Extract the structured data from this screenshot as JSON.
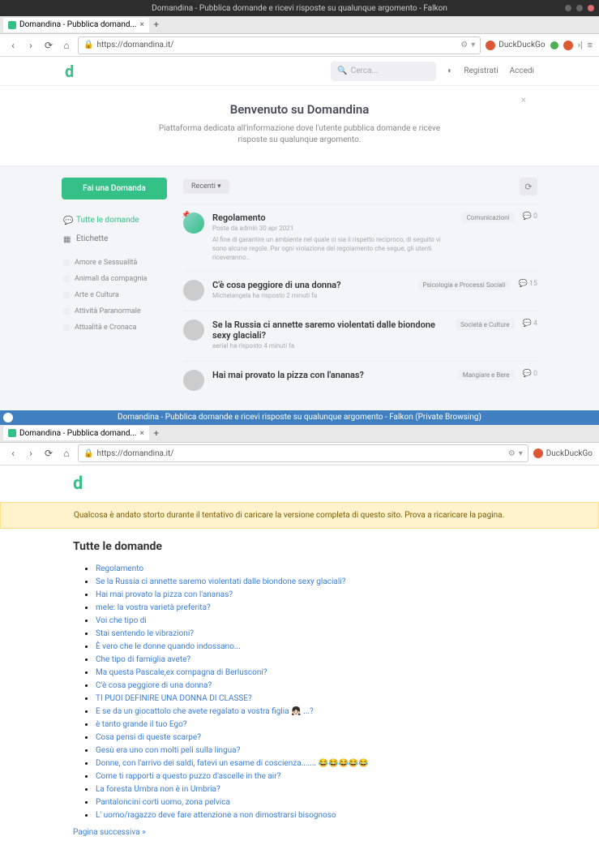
{
  "window1": {
    "title": "Domandina - Pubblica domande e ricevi risposte su qualunque argomento - Falkon",
    "tab": {
      "label": "Domandina - Pubblica domand...",
      "close": "×",
      "add": "+"
    },
    "nav": {
      "back": "‹",
      "forward": "›",
      "reload": "⟳",
      "home": "⌂"
    },
    "address": {
      "lock": "🔒",
      "url": "https://domandina.it/"
    },
    "search_engine": "DuckDuckGo",
    "header": {
      "search_placeholder": "Cerca...",
      "theme_icon": "◐",
      "register": "Registrati",
      "login": "Accedi"
    },
    "welcome": {
      "title": "Benvenuto su Domandina",
      "text": "Piattaforma dedicata all'informazione dove l'utente pubblica domande e riceve risposte su qualunque argomento.",
      "close": "×"
    },
    "sidebar": {
      "ask": "Fai una Domanda",
      "all": "Tutte le domande",
      "tags_label": "Etichette",
      "tags": [
        "Amore e Sessualità",
        "Animali da compagnia",
        "Arte e Cultura",
        "Attività Paranormale",
        "Attualità e Cronaca"
      ]
    },
    "content": {
      "sort": "Recenti ▾",
      "refresh": "⟳"
    },
    "posts": [
      {
        "title": "Regolamento",
        "meta": "Posta da admin 30 apr 2021",
        "excerpt": "Al fine di garantire un ambiente nel quale ci sia il rispetto reciproco, di seguito vi sono alcune regole. Per ogni violazione del regolamento che segue, gli utenti riceveranno...",
        "badge": "Comunicazioni",
        "count": "0"
      },
      {
        "title": "C'è cosa peggiore di una donna?",
        "meta": "Michelangela ha risposto 2 minuti fa",
        "excerpt": "",
        "badge": "Psicologia e Processi Sociali",
        "count": "15"
      },
      {
        "title": "Se la Russia ci annette saremo violentati dalle biondone sexy glaciali?",
        "meta": "aerial ha risposto 4 minuti fa",
        "excerpt": "",
        "badge": "Società e Culture",
        "count": "4"
      },
      {
        "title": "Hai mai provato la pizza con l'ananas?",
        "meta": "",
        "excerpt": "",
        "badge": "Mangiare e Bere",
        "count": "0"
      }
    ]
  },
  "window2": {
    "title": "Domandina - Pubblica domande e ricevi risposte su qualunque argomento - Falkon (Private Browsing)",
    "tab": {
      "label": "Domandina - Pubblica domand...",
      "close": "×",
      "add": "+"
    },
    "address": {
      "url": "https://domandina.it/"
    },
    "search_engine": "DuckDuckGo",
    "error": "Qualcosa è andato storto durante il tentativo di caricare la versione completa di questo sito. Prova a ricaricare la pagina.",
    "heading": "Tutte le domande",
    "links": [
      "Regolamento",
      "Se la Russia ci annette saremo violentati dalle biondone sexy glaciali?",
      "Hai mai provato la pizza con l'ananas?",
      "mele: la vostra varietà preferita?",
      "Voi che tipo di",
      "Stai sentendo le vibrazioni?",
      "È vero che le donne quando indossano...",
      "Che tipo di famiglia avete?",
      "Ma questa Pascale,ex compagna di Berlusconi?",
      "C'è cosa peggiore di una donna?",
      "TI PUOI DEFINIRE UNA DONNA DI CLASSE?",
      "E se da un giocattolo che avete regalato a vostra figlia 👧🏻 ...?",
      "è tanto grande il tuo Ego?",
      "Cosa pensi di queste scarpe?",
      "Gesù era uno con molti peli sulla lingua?",
      "Donne, con l'arrivo dei saldi, fatevi un esame di coscienza....... 😂😂😂😂😂",
      "Come ti rapporti a questo puzzo d'ascelle in the air?",
      "La foresta Umbra non è in Umbria?",
      "Pantaloncini corti uomo, zona pelvica",
      "L' uomo/ragazzo deve fare attenzione a non dimostrarsi bisognoso"
    ],
    "next": "Pagina successiva »"
  }
}
